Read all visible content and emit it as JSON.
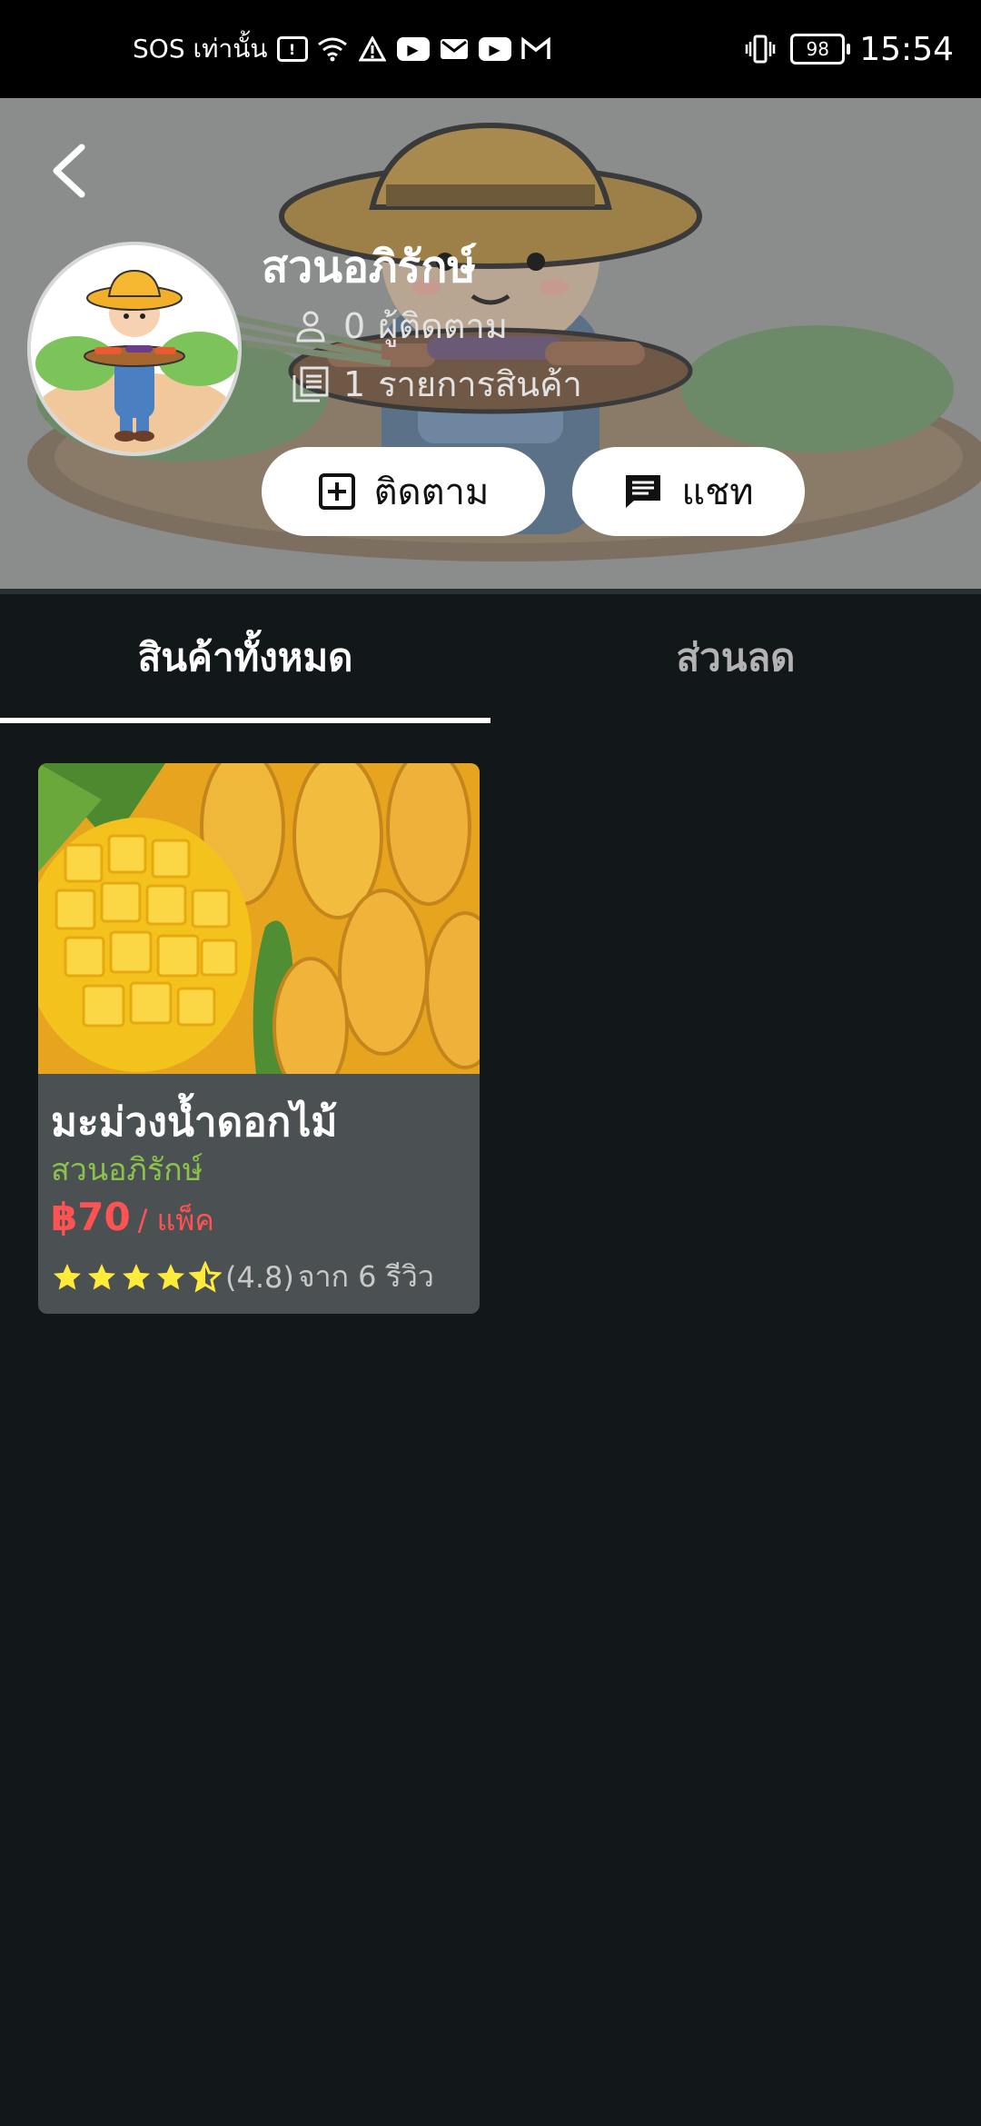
{
  "status_bar": {
    "carrier": "SOS เท่านั้น",
    "battery": "98",
    "time": "15:54"
  },
  "shop": {
    "name": "สวนอภิรักษ์",
    "followers_count": "0",
    "followers_label": "ผู้ติดตาม",
    "products_count": "1",
    "products_label": "รายการสินค้า",
    "follow_label": "ติดตาม",
    "chat_label": "แชท"
  },
  "tabs": {
    "all": "สินค้าทั้งหมด",
    "discount": "ส่วนลด"
  },
  "product": {
    "name": "มะม่วงน้ำดอกไม้",
    "shop": "สวนอภิรักษ์",
    "price": "฿70",
    "unit": "/ แพ็ค",
    "rating_text": "(4.8)",
    "reviews_text": "จาก 6 รีวิว",
    "rating": 4.5
  },
  "colors": {
    "background": "#121819",
    "header_overlay": "#8b8d8d",
    "card": "#4b5152",
    "shop_green": "#8bc34a",
    "price_red": "#ff5252",
    "star_yellow": "#ffeb3b"
  }
}
